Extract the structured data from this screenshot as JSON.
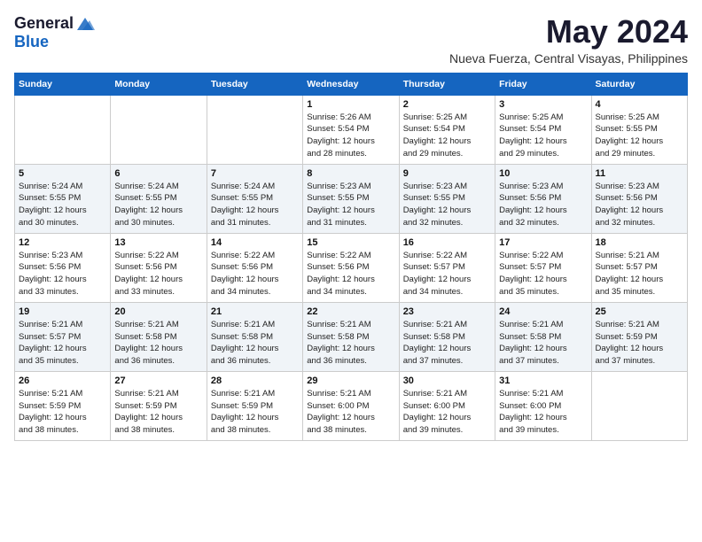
{
  "logo": {
    "general": "General",
    "blue": "Blue"
  },
  "title": "May 2024",
  "location": "Nueva Fuerza, Central Visayas, Philippines",
  "days_of_week": [
    "Sunday",
    "Monday",
    "Tuesday",
    "Wednesday",
    "Thursday",
    "Friday",
    "Saturday"
  ],
  "weeks": [
    [
      {
        "day": "",
        "info": ""
      },
      {
        "day": "",
        "info": ""
      },
      {
        "day": "",
        "info": ""
      },
      {
        "day": "1",
        "info": "Sunrise: 5:26 AM\nSunset: 5:54 PM\nDaylight: 12 hours\nand 28 minutes."
      },
      {
        "day": "2",
        "info": "Sunrise: 5:25 AM\nSunset: 5:54 PM\nDaylight: 12 hours\nand 29 minutes."
      },
      {
        "day": "3",
        "info": "Sunrise: 5:25 AM\nSunset: 5:54 PM\nDaylight: 12 hours\nand 29 minutes."
      },
      {
        "day": "4",
        "info": "Sunrise: 5:25 AM\nSunset: 5:55 PM\nDaylight: 12 hours\nand 29 minutes."
      }
    ],
    [
      {
        "day": "5",
        "info": "Sunrise: 5:24 AM\nSunset: 5:55 PM\nDaylight: 12 hours\nand 30 minutes."
      },
      {
        "day": "6",
        "info": "Sunrise: 5:24 AM\nSunset: 5:55 PM\nDaylight: 12 hours\nand 30 minutes."
      },
      {
        "day": "7",
        "info": "Sunrise: 5:24 AM\nSunset: 5:55 PM\nDaylight: 12 hours\nand 31 minutes."
      },
      {
        "day": "8",
        "info": "Sunrise: 5:23 AM\nSunset: 5:55 PM\nDaylight: 12 hours\nand 31 minutes."
      },
      {
        "day": "9",
        "info": "Sunrise: 5:23 AM\nSunset: 5:55 PM\nDaylight: 12 hours\nand 32 minutes."
      },
      {
        "day": "10",
        "info": "Sunrise: 5:23 AM\nSunset: 5:56 PM\nDaylight: 12 hours\nand 32 minutes."
      },
      {
        "day": "11",
        "info": "Sunrise: 5:23 AM\nSunset: 5:56 PM\nDaylight: 12 hours\nand 32 minutes."
      }
    ],
    [
      {
        "day": "12",
        "info": "Sunrise: 5:23 AM\nSunset: 5:56 PM\nDaylight: 12 hours\nand 33 minutes."
      },
      {
        "day": "13",
        "info": "Sunrise: 5:22 AM\nSunset: 5:56 PM\nDaylight: 12 hours\nand 33 minutes."
      },
      {
        "day": "14",
        "info": "Sunrise: 5:22 AM\nSunset: 5:56 PM\nDaylight: 12 hours\nand 34 minutes."
      },
      {
        "day": "15",
        "info": "Sunrise: 5:22 AM\nSunset: 5:56 PM\nDaylight: 12 hours\nand 34 minutes."
      },
      {
        "day": "16",
        "info": "Sunrise: 5:22 AM\nSunset: 5:57 PM\nDaylight: 12 hours\nand 34 minutes."
      },
      {
        "day": "17",
        "info": "Sunrise: 5:22 AM\nSunset: 5:57 PM\nDaylight: 12 hours\nand 35 minutes."
      },
      {
        "day": "18",
        "info": "Sunrise: 5:21 AM\nSunset: 5:57 PM\nDaylight: 12 hours\nand 35 minutes."
      }
    ],
    [
      {
        "day": "19",
        "info": "Sunrise: 5:21 AM\nSunset: 5:57 PM\nDaylight: 12 hours\nand 35 minutes."
      },
      {
        "day": "20",
        "info": "Sunrise: 5:21 AM\nSunset: 5:58 PM\nDaylight: 12 hours\nand 36 minutes."
      },
      {
        "day": "21",
        "info": "Sunrise: 5:21 AM\nSunset: 5:58 PM\nDaylight: 12 hours\nand 36 minutes."
      },
      {
        "day": "22",
        "info": "Sunrise: 5:21 AM\nSunset: 5:58 PM\nDaylight: 12 hours\nand 36 minutes."
      },
      {
        "day": "23",
        "info": "Sunrise: 5:21 AM\nSunset: 5:58 PM\nDaylight: 12 hours\nand 37 minutes."
      },
      {
        "day": "24",
        "info": "Sunrise: 5:21 AM\nSunset: 5:58 PM\nDaylight: 12 hours\nand 37 minutes."
      },
      {
        "day": "25",
        "info": "Sunrise: 5:21 AM\nSunset: 5:59 PM\nDaylight: 12 hours\nand 37 minutes."
      }
    ],
    [
      {
        "day": "26",
        "info": "Sunrise: 5:21 AM\nSunset: 5:59 PM\nDaylight: 12 hours\nand 38 minutes."
      },
      {
        "day": "27",
        "info": "Sunrise: 5:21 AM\nSunset: 5:59 PM\nDaylight: 12 hours\nand 38 minutes."
      },
      {
        "day": "28",
        "info": "Sunrise: 5:21 AM\nSunset: 5:59 PM\nDaylight: 12 hours\nand 38 minutes."
      },
      {
        "day": "29",
        "info": "Sunrise: 5:21 AM\nSunset: 6:00 PM\nDaylight: 12 hours\nand 38 minutes."
      },
      {
        "day": "30",
        "info": "Sunrise: 5:21 AM\nSunset: 6:00 PM\nDaylight: 12 hours\nand 39 minutes."
      },
      {
        "day": "31",
        "info": "Sunrise: 5:21 AM\nSunset: 6:00 PM\nDaylight: 12 hours\nand 39 minutes."
      },
      {
        "day": "",
        "info": ""
      }
    ]
  ]
}
